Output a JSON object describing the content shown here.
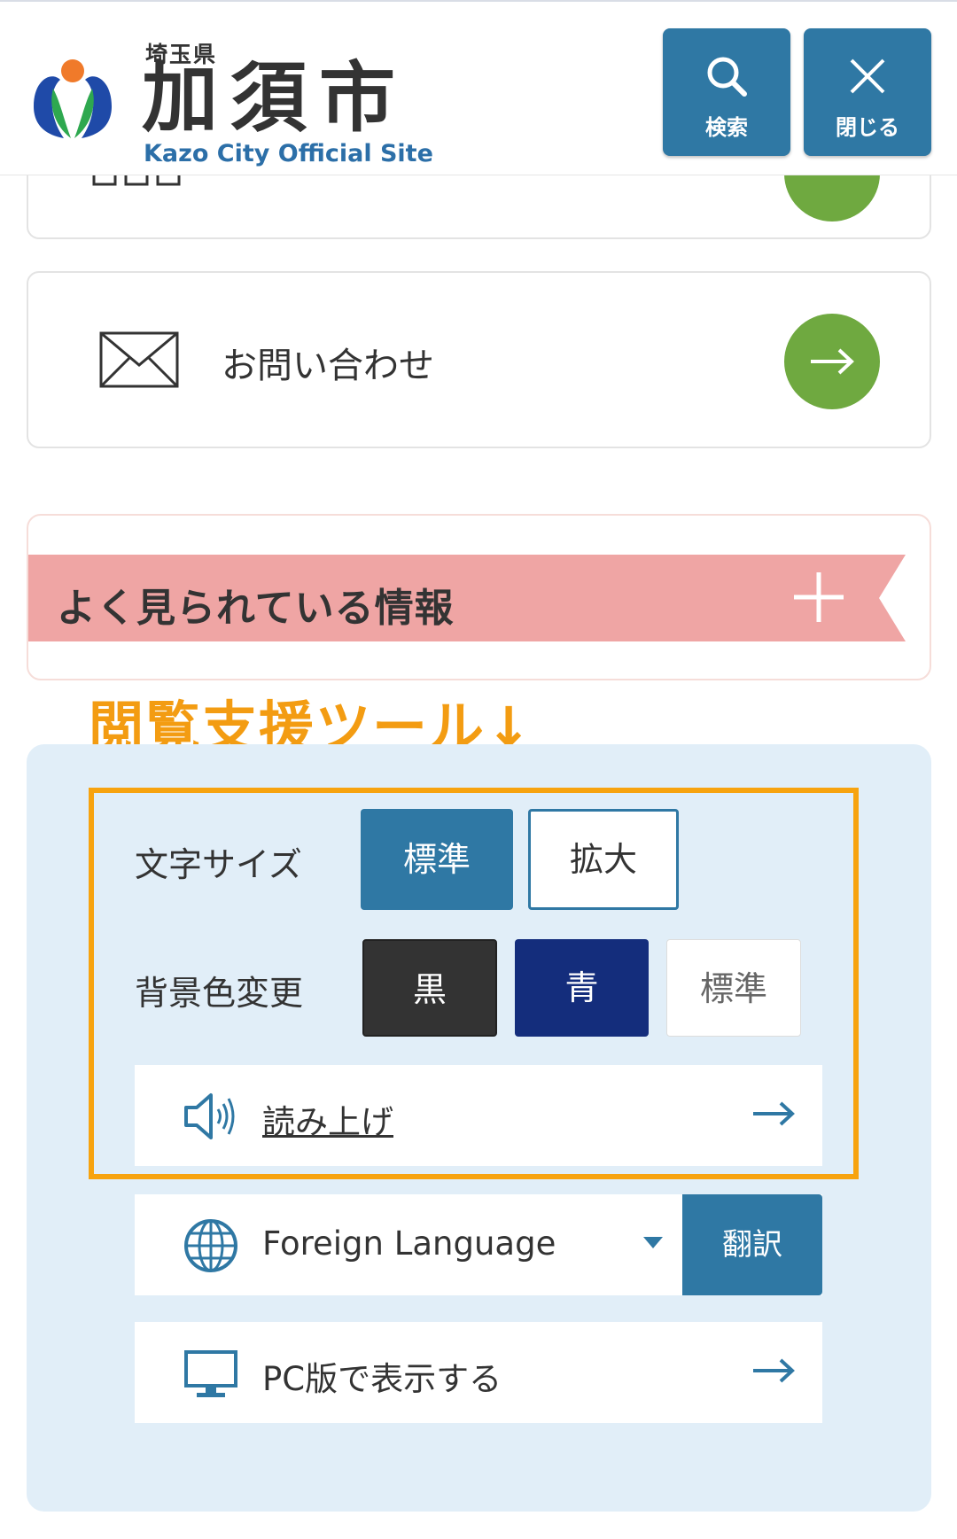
{
  "header": {
    "prefecture": "埼玉県",
    "city_name": "加須市",
    "subtitle": "Kazo City Official Site",
    "search_label": "検索",
    "close_label": "閉じる"
  },
  "menu": {
    "contact_label": "お問い合わせ"
  },
  "popular": {
    "title": "よく見られている情報"
  },
  "annotation": "閲覧支援ツール↓",
  "tools": {
    "font_size_label": "文字サイズ",
    "font_size_standard": "標準",
    "font_size_large": "拡大",
    "bg_color_label": "背景色変更",
    "bg_black": "黒",
    "bg_blue": "青",
    "bg_standard": "標準",
    "read_aloud": "読み上げ",
    "language_select": "Foreign Language",
    "translate_button": "翻訳",
    "pc_view": "PC版で表示する"
  },
  "colors": {
    "header_button": "#2f78a4",
    "green_arrow": "#6fa940",
    "ribbon": "#efa5a4",
    "annotation": "#f39c12",
    "panel": "#e1eef8",
    "bg_blue": "#142d7c"
  }
}
